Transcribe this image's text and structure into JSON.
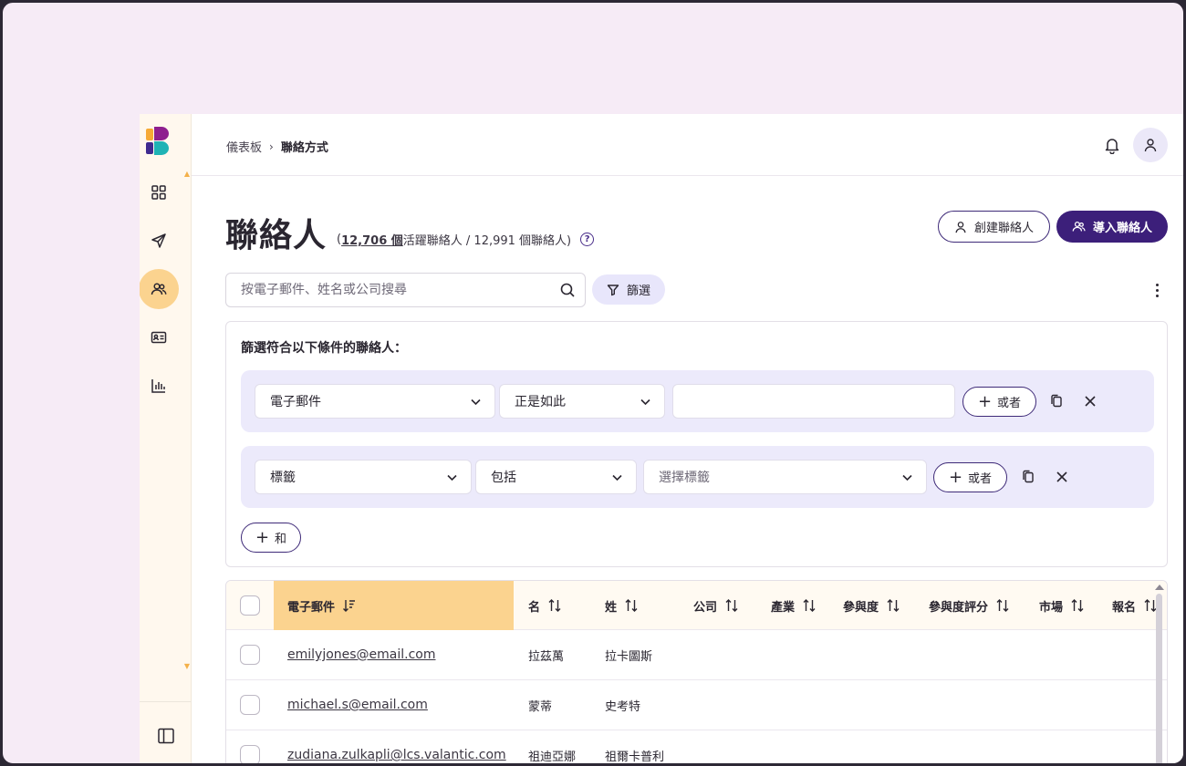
{
  "breadcrumb": {
    "items": [
      "儀表板",
      "聯絡方式"
    ],
    "separator": "›"
  },
  "page": {
    "title": "聯絡人",
    "subtitle_open": "(",
    "active_count": "12,706 個",
    "active_label": "活躍聯絡人 / 12,991 個聯絡人)",
    "help": "?"
  },
  "actions": {
    "create_contact": "創建聯絡人",
    "import_contacts": "導入聯絡人"
  },
  "search": {
    "placeholder": "按電子郵件、姓名或公司搜尋",
    "filter_label": "篩選"
  },
  "filter_panel": {
    "heading": "篩選符合以下條件的聯絡人：",
    "rules": [
      {
        "field": "電子郵件",
        "operator": "正是如此",
        "value": "",
        "or_label": "或者"
      },
      {
        "field": "標籤",
        "operator": "包括",
        "value_placeholder": "選擇標籤",
        "or_label": "或者"
      }
    ],
    "and_label": "和"
  },
  "table": {
    "columns": [
      "電子郵件",
      "名",
      "姓",
      "公司",
      "產業",
      "參與度",
      "參與度評分",
      "市場",
      "報名"
    ],
    "rows": [
      {
        "email": "emilyjones@email.com",
        "first": "拉茲萬",
        "last": "拉卡圖斯"
      },
      {
        "email": "michael.s@email.com",
        "first": "蒙蒂",
        "last": "史考特"
      },
      {
        "email": "zudiana.zulkapli@lcs.valantic.com",
        "first": "祖迪亞娜",
        "last": "祖爾卡普利"
      }
    ]
  },
  "colors": {
    "accent": "#3c1f7a",
    "sidebar_bg": "#fff8ee",
    "active_nav": "#fbd38f",
    "rule_bg": "#eceafb",
    "page_bg": "#f6ebf6"
  },
  "icons": {
    "sidebar": [
      "dashboard-icon",
      "send-icon",
      "contacts-icon",
      "contact-card-icon",
      "chart-icon",
      "sidebar-toggle-icon"
    ],
    "header": [
      "bell-icon",
      "user-icon"
    ]
  }
}
